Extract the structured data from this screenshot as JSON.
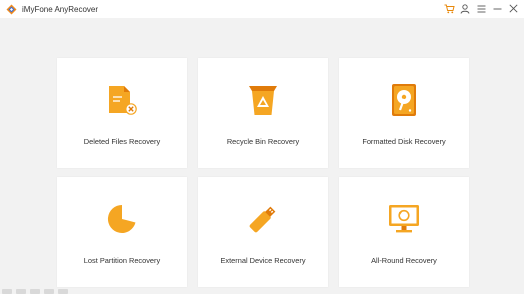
{
  "app": {
    "title": "iMyFone AnyRecover"
  },
  "titlebar": {
    "icons": [
      "cart-icon",
      "user-icon",
      "menu-icon",
      "minimize-icon",
      "close-icon"
    ]
  },
  "colors": {
    "accent": "#F5A623",
    "accent_dark": "#E07B0A",
    "background": "#F2F2F2",
    "card": "#FFFFFF"
  },
  "cards": [
    {
      "label": "Deleted Files Recovery",
      "icon": "deleted-file-icon"
    },
    {
      "label": "Recycle Bin Recovery",
      "icon": "recycle-bin-icon"
    },
    {
      "label": "Formatted Disk Recovery",
      "icon": "formatted-disk-icon"
    },
    {
      "label": "Lost Partition Recovery",
      "icon": "lost-partition-icon"
    },
    {
      "label": "External Device Recovery",
      "icon": "usb-drive-icon"
    },
    {
      "label": "All-Round Recovery",
      "icon": "all-round-monitor-icon"
    }
  ]
}
